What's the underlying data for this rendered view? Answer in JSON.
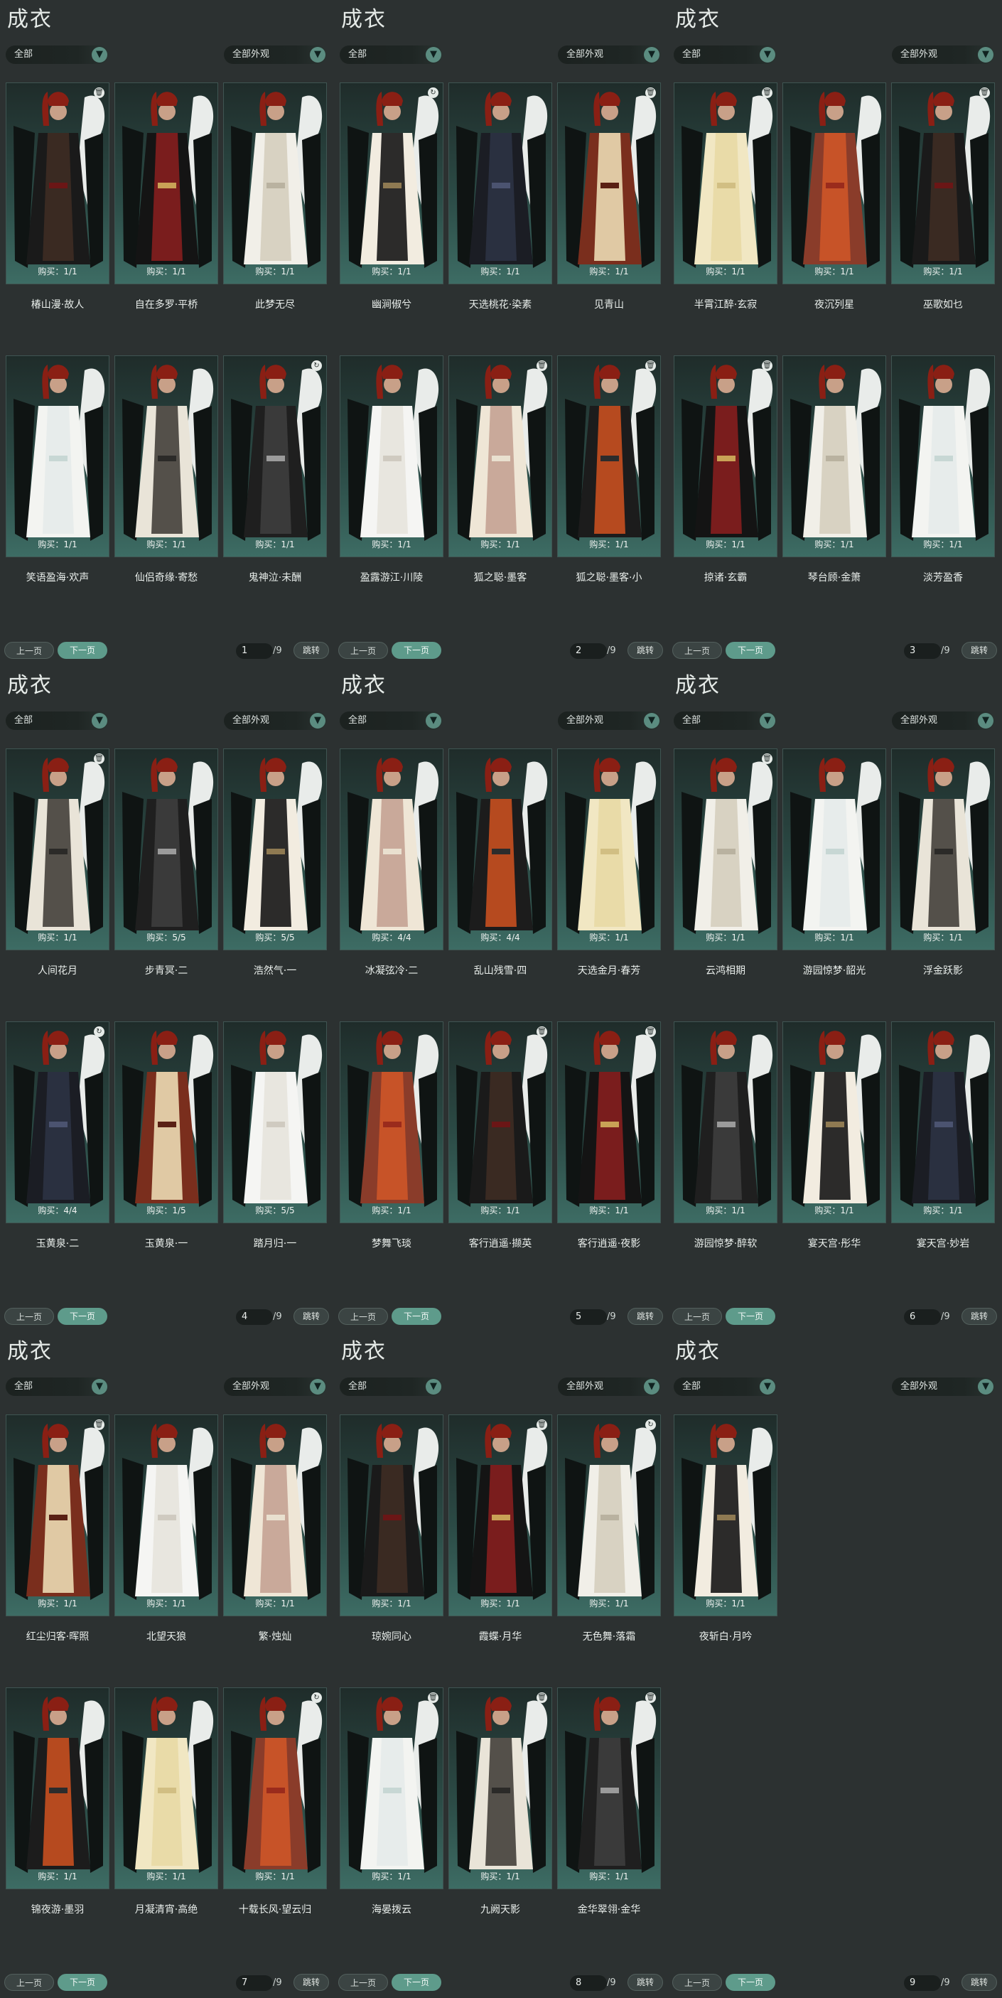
{
  "colors": {
    "bg": "#2c3131",
    "accent": "#5e9b8b",
    "card_top": "#1f2c2a",
    "card_bottom": "#3d6c64"
  },
  "ui": {
    "title": "成衣",
    "filter_left": "全部",
    "filter_right": "全部外观",
    "prev": "上一页",
    "next": "下一页",
    "jump": "跳转",
    "total": "/9"
  },
  "panels": [
    {
      "page": "1",
      "items": [
        {
          "name": "椿山漫·故人",
          "buy": "购买：1/1",
          "icon": "trash-icon"
        },
        {
          "name": "自在多罗·平桥",
          "buy": "购买：1/1",
          "icon": ""
        },
        {
          "name": "此梦无尽",
          "buy": "购买：1/1",
          "icon": ""
        },
        {
          "name": "笑语盈海·欢声",
          "buy": "购买：1/1",
          "icon": ""
        },
        {
          "name": "仙侣奇缘·寄愁",
          "buy": "购买：1/1",
          "icon": ""
        },
        {
          "name": "鬼神泣·未酬",
          "buy": "购买：1/1",
          "icon": "refresh-icon"
        }
      ]
    },
    {
      "page": "2",
      "items": [
        {
          "name": "幽涧俶兮",
          "buy": "购买：1/1",
          "icon": "refresh-icon"
        },
        {
          "name": "天选桃花·染素",
          "buy": "购买：1/1",
          "icon": ""
        },
        {
          "name": "见青山",
          "buy": "购买：1/1",
          "icon": "trash-icon"
        },
        {
          "name": "盈露游江·川陵",
          "buy": "购买：1/1",
          "icon": ""
        },
        {
          "name": "狐之聪·墨客",
          "buy": "购买：1/1",
          "icon": "trash-icon"
        },
        {
          "name": "狐之聪·墨客·小",
          "buy": "购买：1/1",
          "icon": "trash-icon"
        }
      ]
    },
    {
      "page": "3",
      "items": [
        {
          "name": "半霄江醉·玄寂",
          "buy": "购买：1/1",
          "icon": "trash-icon"
        },
        {
          "name": "夜沉列星",
          "buy": "购买：1/1",
          "icon": ""
        },
        {
          "name": "巫歌如乜",
          "buy": "购买：1/1",
          "icon": "trash-icon"
        },
        {
          "name": "掠诸·玄霸",
          "buy": "购买：1/1",
          "icon": "trash-icon"
        },
        {
          "name": "琴台顾·金箫",
          "buy": "购买：1/1",
          "icon": ""
        },
        {
          "name": "淡芳盈香",
          "buy": "购买：1/1",
          "icon": ""
        }
      ]
    },
    {
      "page": "4",
      "items": [
        {
          "name": "人间花月",
          "buy": "购买：1/1",
          "icon": "trash-icon"
        },
        {
          "name": "步青冥·二",
          "buy": "购买：5/5",
          "icon": ""
        },
        {
          "name": "浩然气·一",
          "buy": "购买：5/5",
          "icon": ""
        },
        {
          "name": "玉黄泉·二",
          "buy": "购买：4/4",
          "icon": "refresh-icon"
        },
        {
          "name": "玉黄泉·一",
          "buy": "购买：1/5",
          "icon": ""
        },
        {
          "name": "踏月归·一",
          "buy": "购买：5/5",
          "icon": ""
        }
      ]
    },
    {
      "page": "5",
      "items": [
        {
          "name": "冰凝弦冷·二",
          "buy": "购买：4/4",
          "icon": ""
        },
        {
          "name": "乱山残雪·四",
          "buy": "购买：4/4",
          "icon": ""
        },
        {
          "name": "天选金月·春芳",
          "buy": "购买：1/1",
          "icon": ""
        },
        {
          "name": "梦舞飞琰",
          "buy": "购买：1/1",
          "icon": ""
        },
        {
          "name": "客行逍遥·撷英",
          "buy": "购买：1/1",
          "icon": "trash-icon"
        },
        {
          "name": "客行逍遥·夜影",
          "buy": "购买：1/1",
          "icon": "trash-icon"
        }
      ]
    },
    {
      "page": "6",
      "items": [
        {
          "name": "云鸿相期",
          "buy": "购买：1/1",
          "icon": "trash-icon"
        },
        {
          "name": "游园惊梦·韶光",
          "buy": "购买：1/1",
          "icon": ""
        },
        {
          "name": "浮金跃影",
          "buy": "购买：1/1",
          "icon": ""
        },
        {
          "name": "游园惊梦·醉软",
          "buy": "购买：1/1",
          "icon": ""
        },
        {
          "name": "宴天宫·彤华",
          "buy": "购买：1/1",
          "icon": ""
        },
        {
          "name": "宴天宫·妙岩",
          "buy": "购买：1/1",
          "icon": ""
        }
      ]
    },
    {
      "page": "7",
      "items": [
        {
          "name": "红尘归客·晖照",
          "buy": "购买：1/1",
          "icon": "trash-icon"
        },
        {
          "name": "北望天狼",
          "buy": "购买：1/1",
          "icon": ""
        },
        {
          "name": "繁·烛灿",
          "buy": "购买：1/1",
          "icon": ""
        },
        {
          "name": "锦夜游·墨羽",
          "buy": "购买：1/1",
          "icon": ""
        },
        {
          "name": "月凝清宵·高绝",
          "buy": "购买：1/1",
          "icon": ""
        },
        {
          "name": "十载长风·望云归",
          "buy": "购买：1/1",
          "icon": "refresh-icon"
        }
      ]
    },
    {
      "page": "8",
      "items": [
        {
          "name": "琼婉同心",
          "buy": "购买：1/1",
          "icon": ""
        },
        {
          "name": "霞蝶·月华",
          "buy": "购买：1/1",
          "icon": "trash-icon"
        },
        {
          "name": "无色舞·落霜",
          "buy": "购买：1/1",
          "icon": "refresh-icon"
        },
        {
          "name": "海晏拨云",
          "buy": "购买：1/1",
          "icon": "trash-icon"
        },
        {
          "name": "九阙天影",
          "buy": "购买：1/1",
          "icon": "trash-icon"
        },
        {
          "name": "金华翠翎·金华",
          "buy": "购买：1/1",
          "icon": "trash-icon"
        }
      ]
    },
    {
      "page": "9",
      "items": [
        {
          "name": "夜斩白·月吟",
          "buy": "购买：1/1",
          "icon": ""
        }
      ]
    }
  ]
}
